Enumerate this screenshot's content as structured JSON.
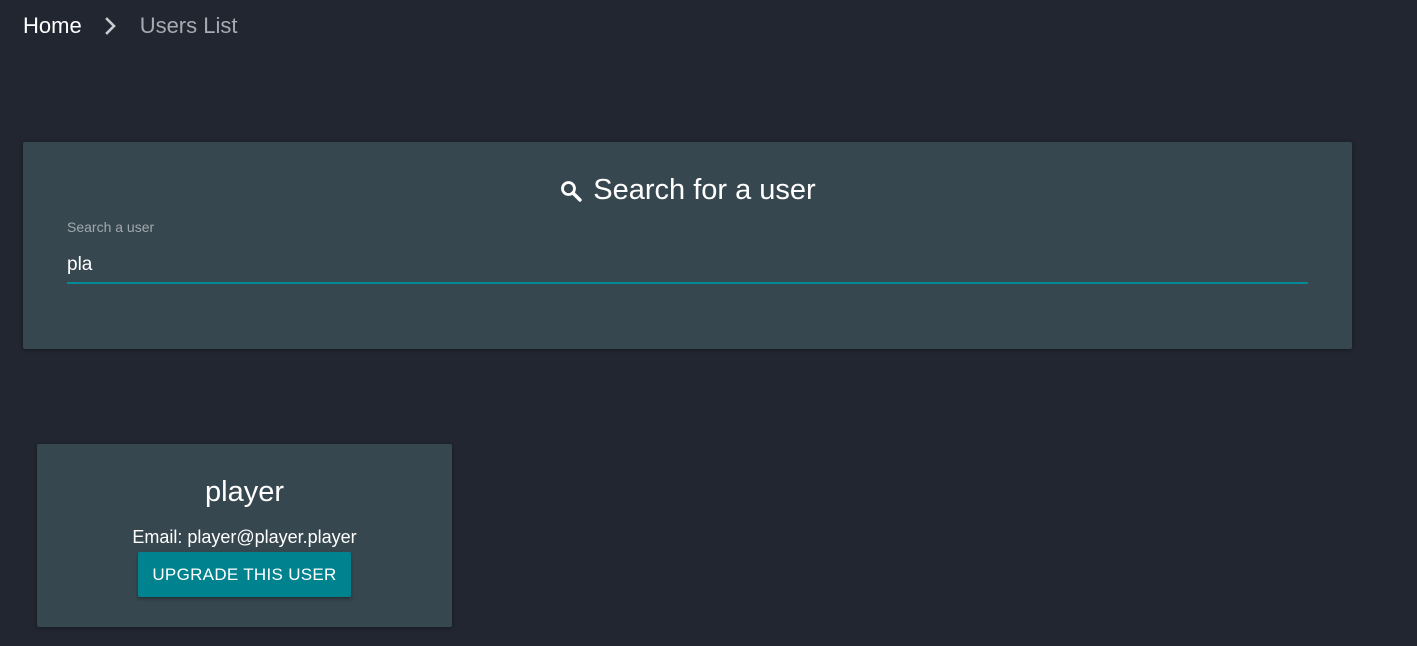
{
  "breadcrumb": {
    "home": "Home",
    "separator_icon": "chevron-right-icon",
    "current": "Users List"
  },
  "search": {
    "title_icon": "search-icon",
    "title": "Search for a user",
    "label": "Search a user",
    "value": "pla"
  },
  "user": {
    "name": "player",
    "email": "Email: player@player.player",
    "upgrade_label": "UPGRADE THIS USER"
  },
  "colors": {
    "background": "#222630",
    "card": "#37474f",
    "accent": "#00838f",
    "muted_text": "#a6abb2"
  }
}
